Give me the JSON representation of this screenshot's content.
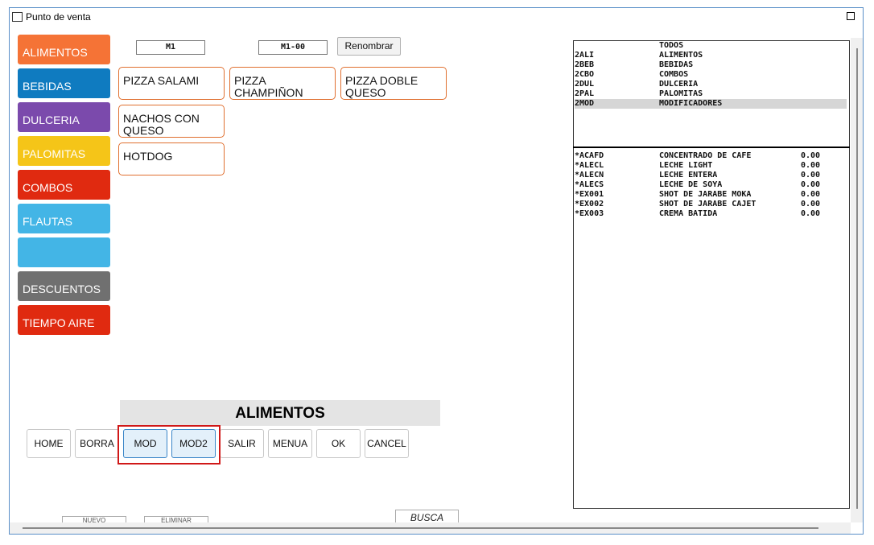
{
  "window": {
    "title": "Punto de venta"
  },
  "categories": [
    {
      "label": "ALIMENTOS",
      "color": "#f57336"
    },
    {
      "label": "BEBIDAS",
      "color": "#0f7bc0"
    },
    {
      "label": "DULCERIA",
      "color": "#7b4aac"
    },
    {
      "label": "PALOMITAS",
      "color": "#f5c518"
    },
    {
      "label": "COMBOS",
      "color": "#e02a10"
    },
    {
      "label": "FLAUTAS",
      "color": "#43b5e6"
    },
    {
      "label": "",
      "color": "#43b5e6"
    },
    {
      "label": "DESCUENTOS",
      "color": "#707070"
    },
    {
      "label": "TIEMPO AIRE",
      "color": "#e02a10"
    }
  ],
  "menu": {
    "name": "M1",
    "code": "M1-00",
    "rename_label": "Renombrar"
  },
  "products": [
    {
      "label": "PIZZA SALAMI"
    },
    {
      "label": "PIZZA CHAMPIÑON"
    },
    {
      "label": "PIZZA DOBLE QUESO"
    },
    {
      "label": "NACHOS CON QUESO"
    },
    {
      "label": "HOTDOG"
    }
  ],
  "section": {
    "title": "ALIMENTOS"
  },
  "actions": [
    {
      "label": "HOME"
    },
    {
      "label": "BORRA"
    },
    {
      "label": "MOD"
    },
    {
      "label": "MOD2"
    },
    {
      "label": "SALIR"
    },
    {
      "label": "MENUA"
    },
    {
      "label": "OK"
    },
    {
      "label": "CANCEL"
    }
  ],
  "bottom": {
    "left1": "NUEVO",
    "left2": "ELIMINAR",
    "busca": "BUSCA PROD"
  },
  "groups": [
    {
      "code": "",
      "name": "TODOS"
    },
    {
      "code": "2ALI",
      "name": "ALIMENTOS"
    },
    {
      "code": "2BEB",
      "name": "BEBIDAS"
    },
    {
      "code": "2CBO",
      "name": "COMBOS"
    },
    {
      "code": "2DUL",
      "name": "DULCERIA"
    },
    {
      "code": "2PAL",
      "name": "PALOMITAS"
    },
    {
      "code": "2MOD",
      "name": "MODIFICADORES"
    }
  ],
  "items": [
    {
      "code": "*ACAFD",
      "name": "CONCENTRADO DE CAFE",
      "price": "0.00"
    },
    {
      "code": "*ALECL",
      "name": "LECHE LIGHT",
      "price": "0.00"
    },
    {
      "code": "*ALECN",
      "name": "LECHE ENTERA",
      "price": "0.00"
    },
    {
      "code": "*ALECS",
      "name": "LECHE DE SOYA",
      "price": "0.00"
    },
    {
      "code": "*EX001",
      "name": "SHOT DE JARABE MOKA",
      "price": "0.00"
    },
    {
      "code": "*EX002",
      "name": "SHOT DE JARABE CAJET",
      "price": "0.00"
    },
    {
      "code": "*EX003",
      "name": "CREMA BATIDA",
      "price": "0.00"
    }
  ]
}
